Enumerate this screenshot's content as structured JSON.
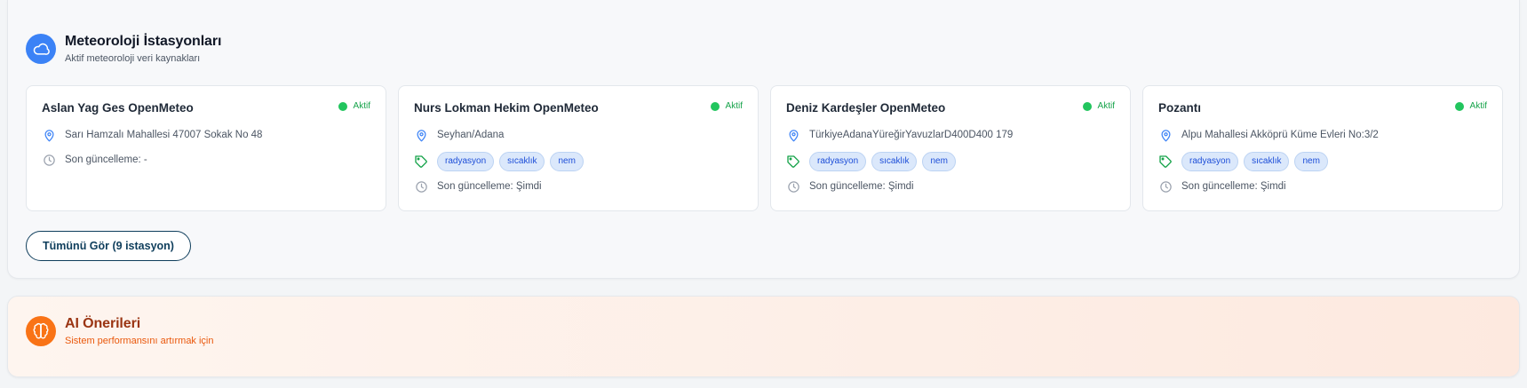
{
  "stations": {
    "title": "Meteoroloji İstasyonları",
    "subtitle": "Aktif meteoroloji veri kaynakları",
    "icon": "cloud-icon",
    "accent": "#3b82f6",
    "cards": [
      {
        "name": "Aslan Yag Ges OpenMeteo",
        "status": "Aktif",
        "location": "Sarı Hamzalı Mahallesi 47007 Sokak No 48",
        "tags": [],
        "last_update": "Son güncelleme: -"
      },
      {
        "name": "Nurs Lokman Hekim OpenMeteo",
        "status": "Aktif",
        "location": "Seyhan/Adana",
        "tags": [
          "radyasyon",
          "sıcaklık",
          "nem"
        ],
        "last_update": "Son güncelleme: Şimdi"
      },
      {
        "name": "Deniz Kardeşler OpenMeteo",
        "status": "Aktif",
        "location": "TürkiyeAdanaYüreğirYavuzlarD400D400 179",
        "tags": [
          "radyasyon",
          "sıcaklık",
          "nem"
        ],
        "last_update": "Son güncelleme: Şimdi"
      },
      {
        "name": "Pozantı",
        "status": "Aktif",
        "location": "Alpu Mahallesi Akköprü Küme Evleri No:3/2",
        "tags": [
          "radyasyon",
          "sıcaklık",
          "nem"
        ],
        "last_update": "Son güncelleme: Şimdi"
      }
    ],
    "view_all_label": "Tümünü Gör (9 istasyon)"
  },
  "ai": {
    "title": "AI Önerileri",
    "subtitle": "Sistem performansını artırmak için",
    "icon": "brain-icon",
    "accent": "#f97316"
  },
  "colors": {
    "status_active": "#22c55e",
    "tag_bg": "#dbe8fb",
    "button_border": "#0f3e5c"
  }
}
